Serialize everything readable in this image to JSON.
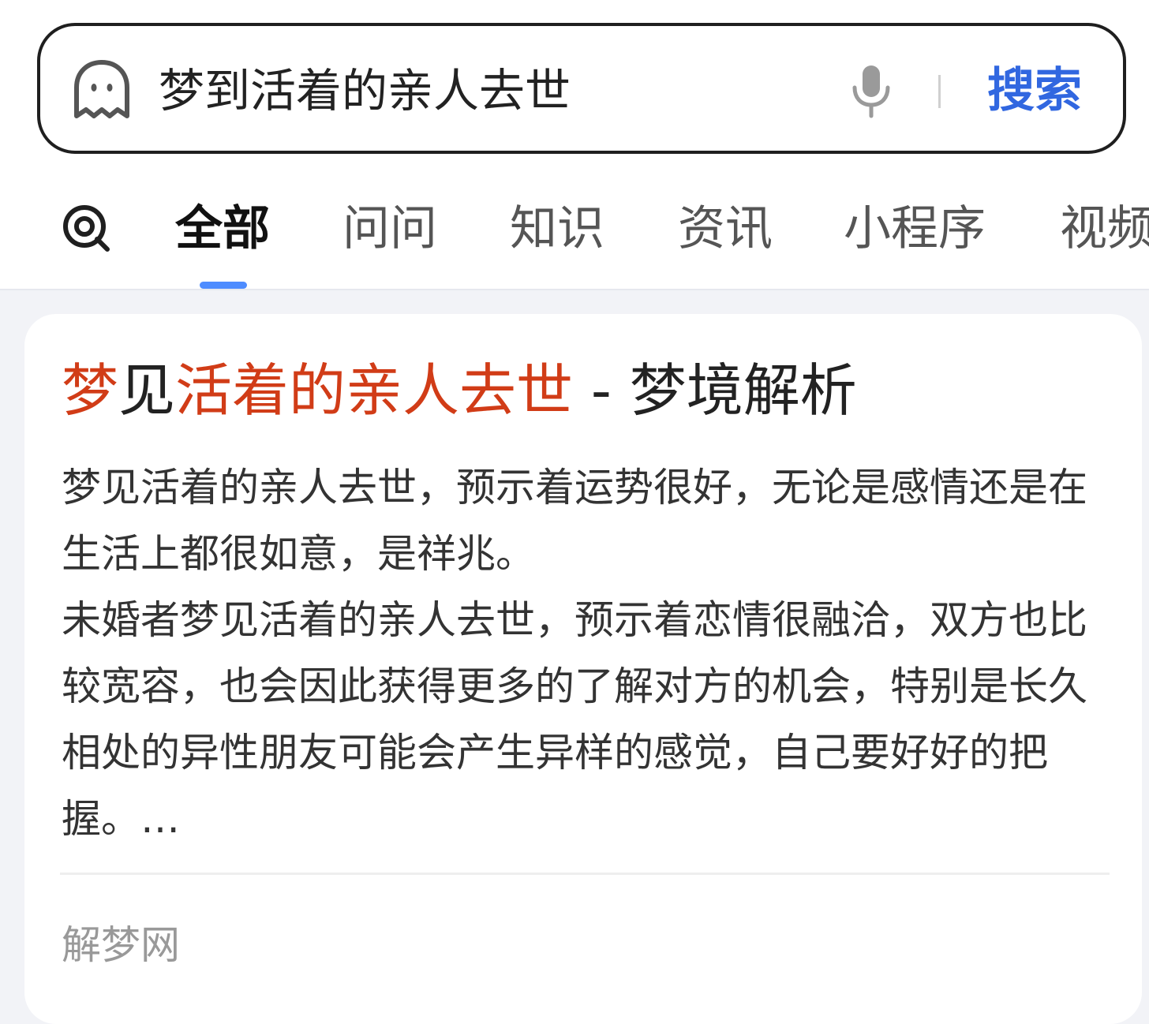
{
  "search": {
    "query": "梦到活着的亲人去世",
    "button_label": "搜索",
    "left_icon": "ghost-icon",
    "voice_icon": "microphone-icon"
  },
  "tabs": {
    "search_icon": "lens-icon",
    "items": [
      {
        "label": "全部",
        "active": true
      },
      {
        "label": "问问",
        "active": false
      },
      {
        "label": "知识",
        "active": false
      },
      {
        "label": "资讯",
        "active": false
      },
      {
        "label": "小程序",
        "active": false
      },
      {
        "label": "视频",
        "active": false
      }
    ]
  },
  "result": {
    "title": {
      "part1": "梦",
      "part2": "见",
      "part3": "活着的亲人去世",
      "part4": " - 梦境解析"
    },
    "paragraphs": [
      "梦见活着的亲人去世，预示着运势很好，无论是感情还是在生活上都很如意，是祥兆。",
      "未婚者梦见活着的亲人去世，预示着恋情很融洽，双方也比较宽容，也会因此获得更多的了解对方的机会，特别是长久相处的异性朋友可能会产生异样的感觉，自己要好好的把握。…"
    ],
    "source": "解梦网"
  },
  "colors": {
    "accent": "#3167e0",
    "highlight": "#d13c17",
    "tab_indicator": "#4e8cff",
    "background": "#f2f3f7"
  }
}
